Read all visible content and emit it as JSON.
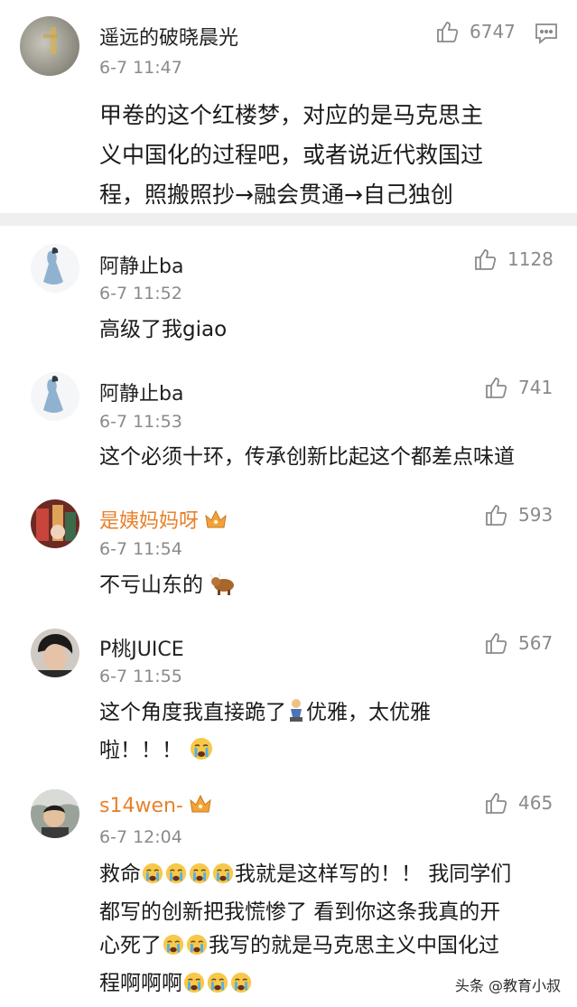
{
  "main_comment": {
    "user": "遥远的破晓晨光",
    "time": "6-7 11:47",
    "likes": "6747",
    "text_lines": [
      "甲卷的这个红楼梦，对应的是马克思主",
      "义中国化的过程吧，或者说近代救国过",
      "程，照搬照抄→融会贯通→自己独创"
    ]
  },
  "replies": [
    {
      "user": "阿静止ba",
      "time": "6-7 11:52",
      "likes": "1128",
      "text": "高级了我giao"
    },
    {
      "user": "阿静止ba",
      "time": "6-7 11:53",
      "likes": "741",
      "text": "这个必须十环，传承创新比起这个都差点味道"
    },
    {
      "user": "是姨妈妈呀",
      "time": "6-7 11:54",
      "likes": "593",
      "text": "不亏山东的"
    },
    {
      "user": "P桃JUICE",
      "time": "6-7 11:55",
      "likes": "567",
      "text_a": "这个角度我直接跪了",
      "text_b": "优雅，太优雅",
      "text_c": "啦！！！"
    },
    {
      "user": "s14wen-",
      "time": "6-7 12:04",
      "likes": "465",
      "line1_a": "救命",
      "line1_b": "我就是这样写的！！ 我同学们",
      "line2": "都写的创新把我慌惨了 看到你这条我真的开",
      "line3_a": "心死了",
      "line3_b": "我写的就是马克思主义中国化过",
      "line4_a": "程啊啊啊"
    }
  ],
  "watermark": "头条 @教育小叔",
  "colors": {
    "vip_name": "#e8812c",
    "meta": "#8a8a8a",
    "divider": "#efefef"
  },
  "icons": [
    "thumb-up-icon",
    "comment-icon",
    "crown-badge-icon",
    "cow-emoji",
    "kneel-emoji",
    "crying-emoji"
  ]
}
